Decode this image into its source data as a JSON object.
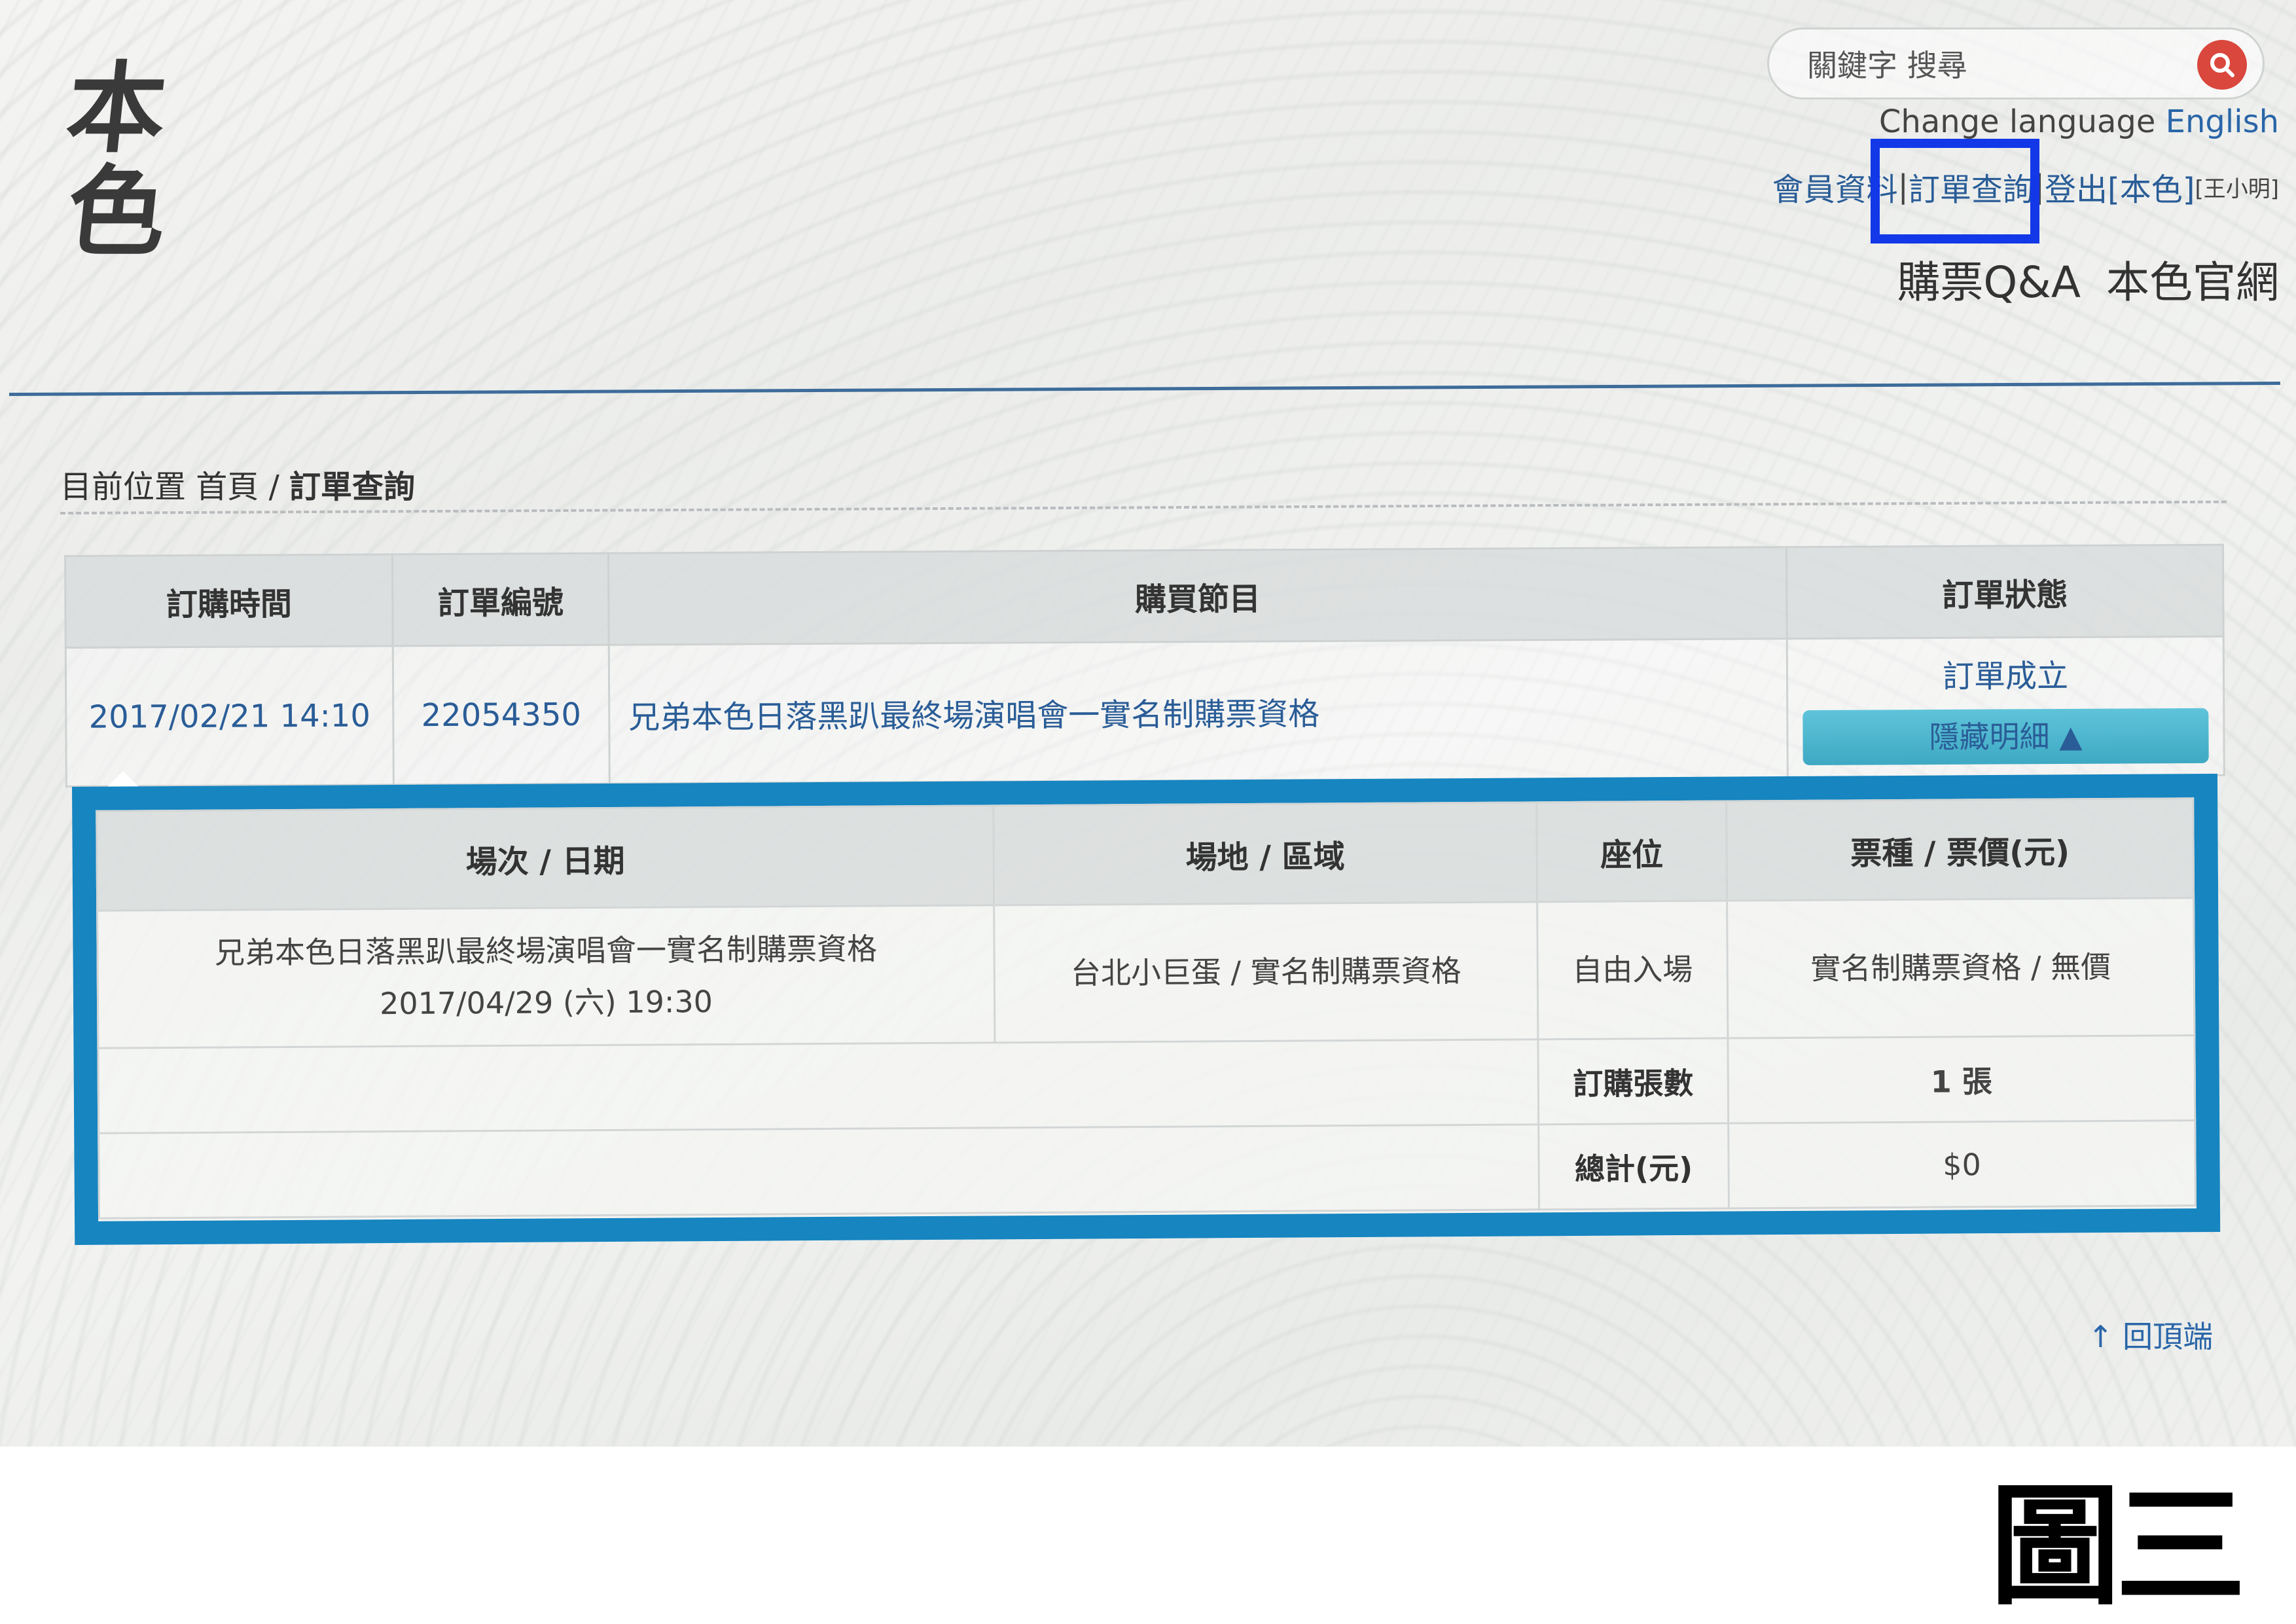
{
  "logo": {
    "line1": "本",
    "line2": "色"
  },
  "search": {
    "placeholder": "關鍵字 搜尋"
  },
  "language": {
    "label": "Change language",
    "option": "English"
  },
  "member_nav": {
    "profile": "會員資料",
    "separator": "|",
    "orders": "訂單查詢",
    "logout": "登出[本色]",
    "user": "[王小明]"
  },
  "site_links": {
    "qa": "購票Q&A",
    "official": "本色官網"
  },
  "breadcrumb": {
    "prefix": "目前位置",
    "home": "首頁",
    "sep": "/",
    "current": "訂單查詢"
  },
  "order_table": {
    "headers": [
      "訂購時間",
      "訂單編號",
      "購買節目",
      "訂單狀態"
    ],
    "row": {
      "time": "2017/02/21 14:10",
      "order_no": "22054350",
      "program": "兄弟本色日落黑趴最終場演唱會一實名制購票資格",
      "status": "訂單成立",
      "detail_button": "隱藏明細 ▲"
    }
  },
  "detail": {
    "headers": [
      "場次 / 日期",
      "場地 / 區域",
      "座位",
      "票種 / 票價(元)"
    ],
    "item": {
      "session": "兄弟本色日落黑趴最終場演唱會一實名制購票資格",
      "date": "2017/04/29 (六) 19:30",
      "venue": "台北小巨蛋 / 實名制購票資格",
      "seat": "自由入場",
      "ticket": "實名制購票資格 / 無價"
    },
    "qty_label": "訂購張數",
    "qty_value": "1 張",
    "total_label": "總計(元)",
    "total_value": "$0"
  },
  "back_to_top": "↑ 回頂端",
  "figure_label": "圖三",
  "colors": {
    "accent_blue": "#1685c0",
    "link_blue": "#2a5d97",
    "highlight_box": "#1238e8",
    "price_red": "#d9473d"
  }
}
